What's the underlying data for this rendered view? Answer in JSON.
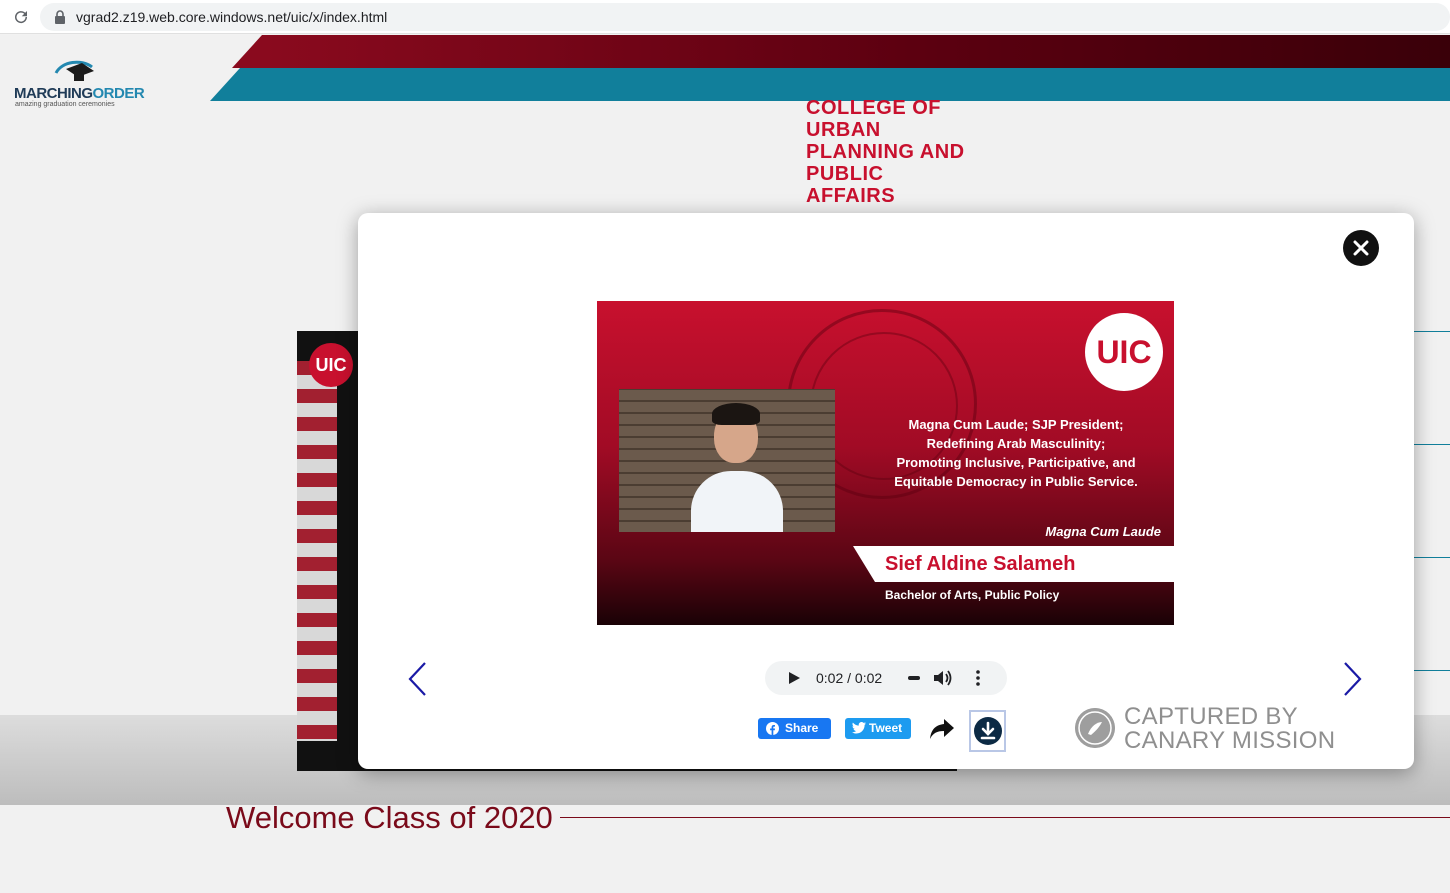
{
  "browser": {
    "url": "vgrad2.z19.web.core.windows.net/uic/x/index.html"
  },
  "header": {
    "logo_word_1": "MARCHING",
    "logo_word_2": "ORDER",
    "logo_tagline": "amazing graduation ceremonies",
    "college_lines": [
      "COLLEGE OF",
      "URBAN",
      "PLANNING AND",
      "PUBLIC",
      "AFFAIRS"
    ]
  },
  "background_video": {
    "badge": "UIC"
  },
  "welcome": {
    "text": "Welcome Class of 2020"
  },
  "modal": {
    "slide": {
      "logo": "UIC",
      "quote_lines": [
        "Magna Cum Laude; SJP President;",
        "Redefining Arab Masculinity;",
        "Promoting Inclusive, Participative, and",
        "Equitable Democracy in Public Service."
      ],
      "honor": "Magna Cum Laude",
      "name": "Sief Aldine Salameh",
      "degree": "Bachelor of Arts, Public Policy"
    },
    "audio": {
      "time": "0:02 / 0:02"
    },
    "share": {
      "facebook_label": "Share",
      "twitter_label": "Tweet"
    },
    "watermark": {
      "line1": "CAPTURED BY",
      "line2": "CANARY MISSION"
    }
  },
  "colors": {
    "uic_red": "#c8102e",
    "teal_band": "#117f9b",
    "maroon_band": "#5c0010",
    "facebook_blue": "#1877f2",
    "twitter_blue": "#1d9bf0"
  }
}
